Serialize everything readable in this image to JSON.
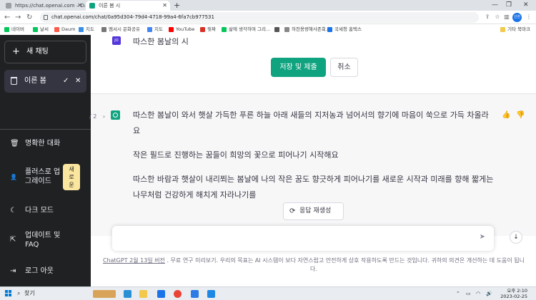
{
  "browser": {
    "tabs": [
      {
        "title": "https://chat.openai.com – Daum"
      },
      {
        "title": "이른 봄 시"
      }
    ],
    "new_tab": "+",
    "url": "chat.openai.com/chat/0a95d304-79d4-4718-99a4-6fa7cb977531",
    "profile": "신한",
    "bookmarks": [
      {
        "label": "네이버",
        "color": "#03c75a"
      },
      {
        "label": "날씨",
        "color": "#03c75a"
      },
      {
        "label": "Daum",
        "color": "#ff5a4a"
      },
      {
        "label": "지도",
        "color": "#3a8ee6"
      },
      {
        "label": "엠서시 문화공유",
        "color": "#777777"
      },
      {
        "label": "지도",
        "color": "#4285f4"
      },
      {
        "label": "YouTube",
        "color": "#ff0000"
      },
      {
        "label": "뭣짜",
        "color": "#d93025"
      },
      {
        "label": "삶에 생각하며 그리...",
        "color": "#03c75a"
      },
      {
        "label": "",
        "color": "#555555"
      },
      {
        "label": "하천용량해사존회...",
        "color": "#888888"
      },
      {
        "label": "국세청 홈택스",
        "color": "#1a73e8"
      }
    ],
    "other_bookmarks": "기타 북마크"
  },
  "sidebar": {
    "new_chat": "새 채팅",
    "current_chat": "이른 봄",
    "items": [
      {
        "label": "명확한 대화",
        "icon": "trash-icon"
      },
      {
        "label": "플러스로 업그레이드",
        "icon": "user-icon",
        "badge": "새로운"
      },
      {
        "label": "다크 모드",
        "icon": "moon-icon"
      },
      {
        "label": "업데이트 및 FAQ",
        "icon": "external-link-icon"
      },
      {
        "label": "로그 아웃",
        "icon": "logout-icon"
      }
    ],
    "upgrade_line1": "플러스로 업",
    "upgrade_line2": "그레이드",
    "badge_line1": "새",
    "badge_line2": "로",
    "badge_line3": "운",
    "faq_line1": "업데이트 및",
    "faq_line2": "FAQ"
  },
  "conversation": {
    "user_avatar": "JO",
    "user_message": "따스한 봄날의 시",
    "save_button": "저장 및 제출",
    "cancel_button": "취소",
    "pager": "/ 2",
    "answer_paragraphs": [
      "따스한 봄날이 와서 햇살 가득한 푸른 하늘 아래 새들의 지저농과 넘어서의 향기에 마음이 쑥으로 가득 차올라요",
      "작은 필드로 진행하는 꿈들이 희망의 꽃으로 피어나기 시작해요",
      "따스한 바람과 햇살이 내리쬐는 봄날에 나의 작은 꿈도 향긋하게 피어나기를 새로운 시작과 미래를 향해 짧게는 나무처럼 건강하게 해치게 자라나기를"
    ],
    "regenerate": "응답 재생성"
  },
  "footer": {
    "link": "ChatGPT 2월 13일 버전",
    "text": ". 무료 연구 미리보기. 우리의 목표는 AI 시스템이 보다 자연스럽고 안전하게 상호 작용하도록 만드는 것입니다. 귀하의 의견은 개선하는 데 도움이 됩니다."
  },
  "taskbar": {
    "search": "찾기",
    "time": "오후 2:10",
    "date": "2023-02-25"
  }
}
